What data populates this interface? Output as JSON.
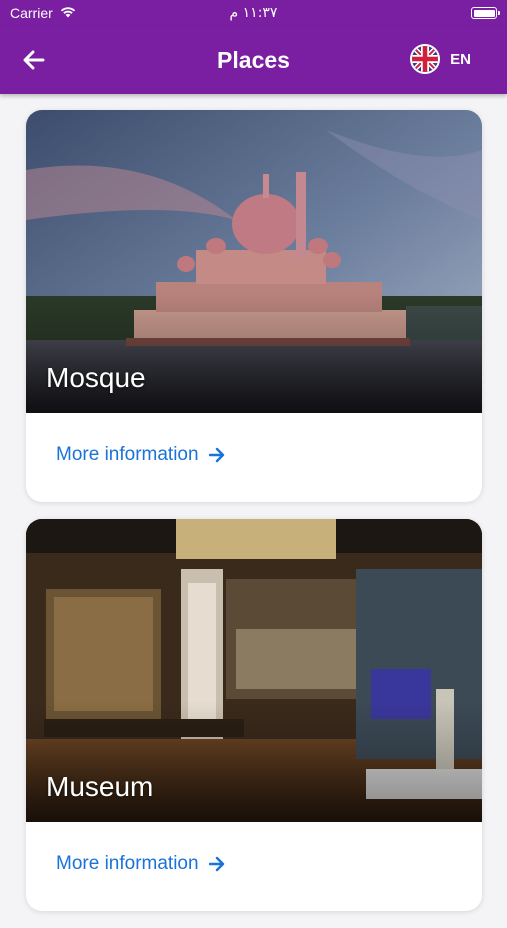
{
  "status_bar": {
    "carrier": "Carrier",
    "time": "١١:٣٧ م"
  },
  "app_bar": {
    "title": "Places",
    "language": "EN"
  },
  "places": [
    {
      "name": "Mosque",
      "link_label": "More information"
    },
    {
      "name": "Museum",
      "link_label": "More information"
    }
  ],
  "colors": {
    "primary": "#7a1fa2",
    "link": "#1a73d9"
  },
  "icons": {
    "back": "arrow-left-icon",
    "flag": "uk-flag-icon",
    "link": "arrow-right-icon"
  }
}
